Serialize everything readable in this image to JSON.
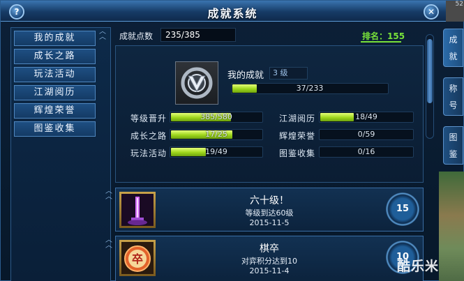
{
  "window": {
    "title": "成就系统",
    "help_glyph": "?",
    "close_glyph": "✕",
    "corner_text": "52"
  },
  "sidebar": {
    "items": [
      {
        "label": "我的成就"
      },
      {
        "label": "成长之路"
      },
      {
        "label": "玩法活动"
      },
      {
        "label": "江湖阅历"
      },
      {
        "label": "辉煌荣誉"
      },
      {
        "label": "图鉴收集"
      }
    ]
  },
  "header": {
    "points_label": "成就点数",
    "points_value": "235/385",
    "rank_text": "排名：155"
  },
  "summary": {
    "title": "我的成就",
    "level": "3 级",
    "progress_text": "37/233",
    "progress_fraction": 0.159,
    "stats": [
      {
        "label": "等级晋升",
        "text": "385/580",
        "fraction": 0.664
      },
      {
        "label": "成长之路",
        "text": "17/25",
        "fraction": 0.68
      },
      {
        "label": "玩法活动",
        "text": "19/49",
        "fraction": 0.388
      },
      {
        "label": "江湖阅历",
        "text": "18/49",
        "fraction": 0.367
      },
      {
        "label": "辉煌荣誉",
        "text": "0/59",
        "fraction": 0
      },
      {
        "label": "图鉴收集",
        "text": "0/16",
        "fraction": 0
      }
    ]
  },
  "achievements": [
    {
      "title": "六十级！",
      "desc": "等级到达60级",
      "date": "2015-11-5",
      "points": "15",
      "icon": "purple-sword-icon"
    },
    {
      "title": "棋卒",
      "desc": "对弈积分达到10",
      "date": "2015-11-4",
      "points": "10",
      "icon": "chess-piece-icon"
    }
  ],
  "chess_glyph": "卒",
  "right_tabs": [
    {
      "label": "成\n就",
      "active": true
    },
    {
      "label": "称\n号",
      "active": false
    },
    {
      "label": "图\n鉴",
      "active": false
    }
  ],
  "watermark": "酷乐米",
  "colors": {
    "accent_green": "#78e23a",
    "bar_fill": "#b6e62a",
    "frame_blue": "#2b5c8e"
  }
}
